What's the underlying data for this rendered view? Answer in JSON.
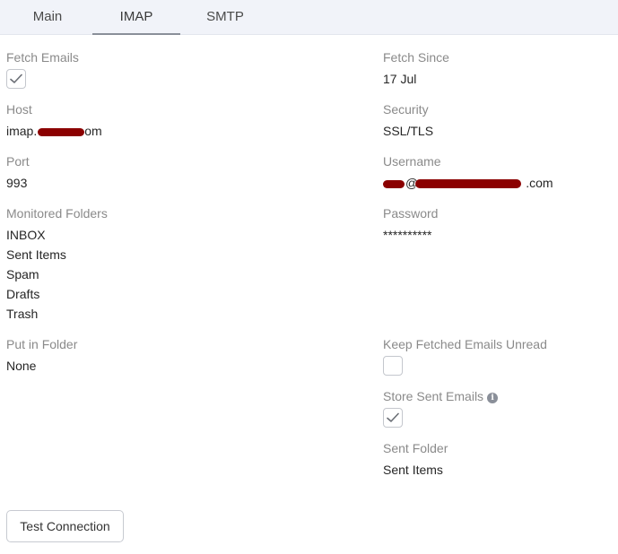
{
  "tabs": [
    {
      "label": "Main"
    },
    {
      "label": "IMAP"
    },
    {
      "label": "SMTP"
    }
  ],
  "fields": {
    "fetch_emails": {
      "label": "Fetch Emails",
      "checked": true
    },
    "fetch_since": {
      "label": "Fetch Since",
      "value": "17 Jul"
    },
    "host": {
      "label": "Host",
      "value_prefix": "imap.",
      "value_suffix": "om"
    },
    "security": {
      "label": "Security",
      "value": "SSL/TLS"
    },
    "port": {
      "label": "Port",
      "value": "993"
    },
    "username": {
      "label": "Username",
      "value_mid": "@",
      "value_suffix": ".com"
    },
    "monitored_folders": {
      "label": "Monitored Folders",
      "items": [
        "INBOX",
        "Sent Items",
        "Spam",
        "Drafts",
        "Trash"
      ]
    },
    "password": {
      "label": "Password",
      "value": "**********"
    },
    "put_in_folder": {
      "label": "Put in Folder",
      "value": "None"
    },
    "keep_unread": {
      "label": "Keep Fetched Emails Unread",
      "checked": false
    },
    "store_sent": {
      "label": "Store Sent Emails",
      "checked": true,
      "info_icon": "info-icon"
    },
    "sent_folder": {
      "label": "Sent Folder",
      "value": "Sent Items"
    }
  },
  "actions": {
    "test_connection": "Test Connection"
  },
  "colors": {
    "redaction": "#8b0000",
    "tab_bar": "#f1f3f9",
    "label": "#8a8a8a"
  }
}
